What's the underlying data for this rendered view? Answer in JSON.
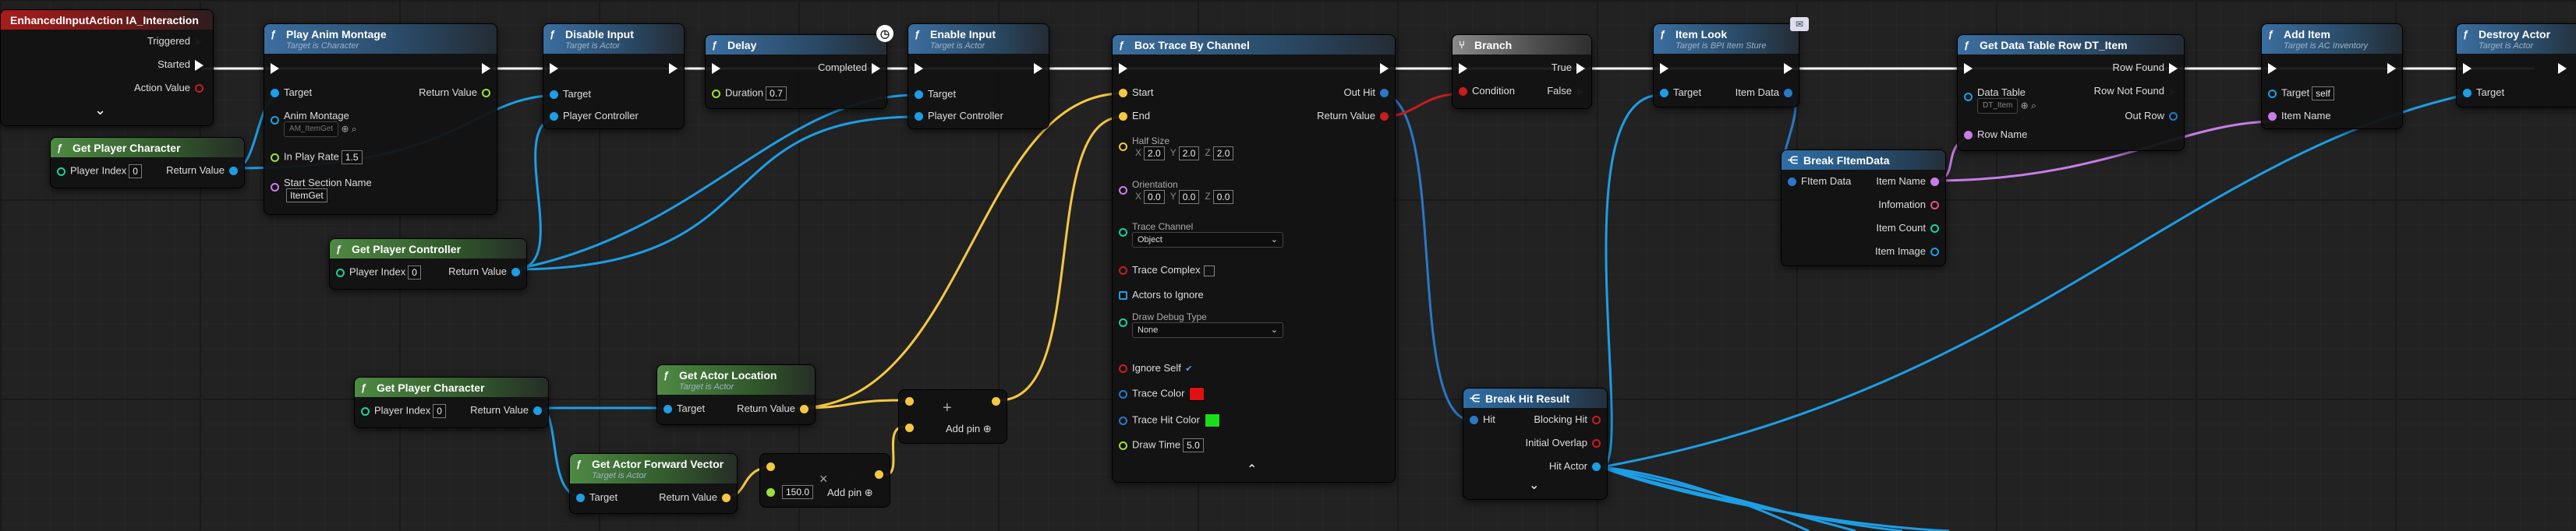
{
  "colors": {
    "exec": "#ffffff",
    "object": "#1d9ee6",
    "integer": "#1ccfa0",
    "float": "#9be03c",
    "vector": "#f5c842",
    "bool": "#c81d1d",
    "name": "#c77ee8",
    "struct": "#2a78c7",
    "linear_color": "#2a78c7"
  },
  "nodes": {
    "event": {
      "title": "EnhancedInputAction IA_Interaction",
      "triggered": "Triggered",
      "started": "Started",
      "action_value": "Action Value",
      "expand": "⌄"
    },
    "play_anim": {
      "title": "Play Anim Montage",
      "subtitle": "Target is Character",
      "target": "Target",
      "return_value": "Return Value",
      "anim_montage": "Anim Montage",
      "anim_value": "AM_ItemGet",
      "play_rate": "In Play Rate",
      "play_rate_value": "1.5",
      "start_section": "Start Section Name",
      "start_section_value": "ItemGet"
    },
    "get_player_char_1": {
      "title": "Get Player Character",
      "player_index": "Player Index",
      "player_index_value": "0",
      "return_value": "Return Value"
    },
    "disable_input": {
      "title": "Disable Input",
      "subtitle": "Target is Actor",
      "target": "Target",
      "player_controller": "Player Controller"
    },
    "get_player_controller": {
      "title": "Get Player Controller",
      "player_index": "Player Index",
      "player_index_value": "0",
      "return_value": "Return Value"
    },
    "delay": {
      "title": "Delay",
      "completed": "Completed",
      "duration": "Duration",
      "duration_value": "0.7"
    },
    "enable_input": {
      "title": "Enable Input",
      "subtitle": "Target is Actor",
      "target": "Target",
      "player_controller": "Player Controller"
    },
    "box_trace": {
      "title": "Box Trace By Channel",
      "start": "Start",
      "end": "End",
      "out_hit": "Out Hit",
      "return_value": "Return Value",
      "half_size": "Half Size",
      "half_size_x": "2.0",
      "half_size_y": "2.0",
      "half_size_z": "2.0",
      "orientation": "Orientation",
      "orientation_x": "0.0",
      "orientation_y": "0.0",
      "orientation_z": "0.0",
      "trace_channel": "Trace Channel",
      "trace_channel_value": "Object",
      "trace_complex": "Trace Complex",
      "actors_to_ignore": "Actors to Ignore",
      "draw_debug_type": "Draw Debug Type",
      "draw_debug_value": "None",
      "ignore_self": "Ignore Self",
      "trace_color": "Trace Color",
      "trace_hit_color": "Trace Hit Color",
      "draw_time": "Draw Time",
      "draw_time_value": "5.0",
      "trace_color_hex": "#e01010",
      "trace_hit_color_hex": "#18e018",
      "collapse": "⌃"
    },
    "branch": {
      "title": "Branch",
      "condition": "Condition",
      "true_label": "True",
      "false_label": "False"
    },
    "item_look": {
      "title": "Item Look",
      "subtitle": "Target is BPI Item Sture",
      "target": "Target",
      "item_data": "Item Data"
    },
    "break_fitem": {
      "title": "Break FItemData",
      "fitem_data": "FItem Data",
      "item_name": "Item Name",
      "infomation": "Infomation",
      "item_count": "Item Count",
      "item_image": "Item Image"
    },
    "get_data_table": {
      "title": "Get Data Table Row DT_Item",
      "row_found": "Row Found",
      "row_not_found": "Row Not Found",
      "data_table": "Data Table",
      "data_table_value": "DT_Item",
      "row_name": "Row Name",
      "out_row": "Out Row"
    },
    "add_item": {
      "title": "Add Item",
      "subtitle": "Target is AC Inventory",
      "target": "Target",
      "target_value": "self",
      "item_name": "Item Name"
    },
    "destroy_actor": {
      "title": "Destroy Actor",
      "subtitle": "Target is Actor",
      "target": "Target"
    },
    "get_player_char_2": {
      "title": "Get Player Character",
      "player_index": "Player Index",
      "player_index_value": "0",
      "return_value": "Return Value"
    },
    "get_actor_location": {
      "title": "Get Actor Location",
      "subtitle": "Target is Actor",
      "target": "Target",
      "return_value": "Return Value"
    },
    "get_forward_vector": {
      "title": "Get Actor Forward Vector",
      "subtitle": "Target is Actor",
      "target": "Target",
      "return_value": "Return Value"
    },
    "add_node_1": {
      "add_pin": "Add pin",
      "plus": "+"
    },
    "multiply_node": {
      "value": "150.0",
      "add_pin": "Add pin",
      "times": "×"
    },
    "break_hit": {
      "title": "Break Hit Result",
      "hit": "Hit",
      "blocking_hit": "Blocking Hit",
      "initial_overlap": "Initial Overlap",
      "hit_actor": "Hit Actor",
      "expand": "⌄"
    }
  }
}
